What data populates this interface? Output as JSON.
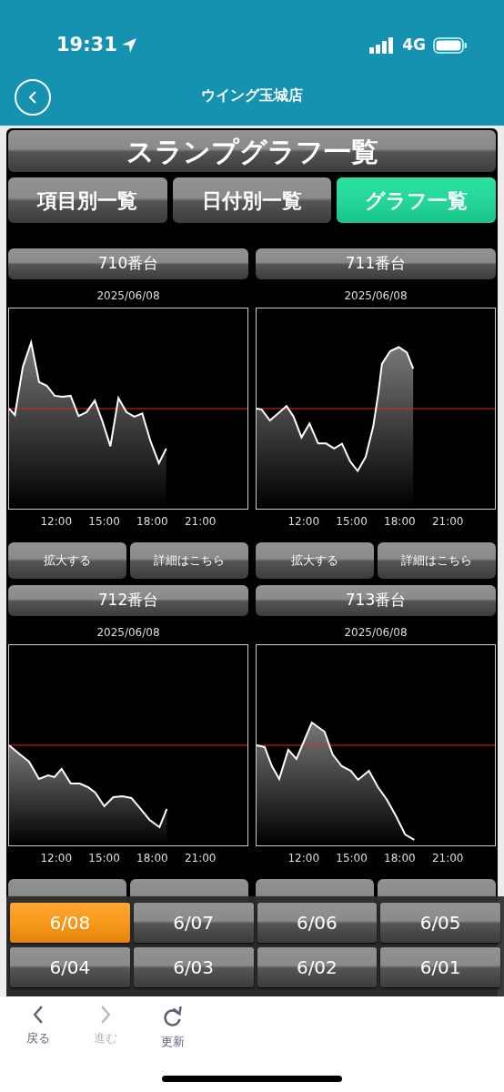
{
  "status_bar": {
    "time": "19:31",
    "network": "4G"
  },
  "header": {
    "title": "ウイング玉城店"
  },
  "page_title": "スランプグラフ一覧",
  "tabs": [
    {
      "label": "項目別一覧",
      "selected": false
    },
    {
      "label": "日付別一覧",
      "selected": false
    },
    {
      "label": "グラフ一覧",
      "selected": true
    }
  ],
  "machines": [
    {
      "label": "710番台",
      "date": "2025/06/08",
      "x_ticks": [
        "12:00",
        "15:00",
        "18:00",
        "21:00"
      ],
      "buttons": [
        "拡大する",
        "詳細はこちら"
      ]
    },
    {
      "label": "711番台",
      "date": "2025/06/08",
      "x_ticks": [
        "12:00",
        "15:00",
        "18:00",
        "21:00"
      ],
      "buttons": [
        "拡大する",
        "詳細はこちら"
      ]
    },
    {
      "label": "712番台",
      "date": "2025/06/08",
      "x_ticks": [
        "12:00",
        "15:00",
        "18:00",
        "21:00"
      ]
    },
    {
      "label": "713番台",
      "date": "2025/06/08",
      "x_ticks": [
        "12:00",
        "15:00",
        "18:00",
        "21:00"
      ]
    }
  ],
  "dates": [
    {
      "label": "6/08",
      "selected": true
    },
    {
      "label": "6/07",
      "selected": false
    },
    {
      "label": "6/06",
      "selected": false
    },
    {
      "label": "6/05",
      "selected": false
    },
    {
      "label": "6/04",
      "selected": false
    },
    {
      "label": "6/03",
      "selected": false
    },
    {
      "label": "6/02",
      "selected": false
    },
    {
      "label": "6/01",
      "selected": false
    }
  ],
  "toolbar": [
    {
      "kind": "back",
      "label": "戻る",
      "disabled": false
    },
    {
      "kind": "forward",
      "label": "進む",
      "disabled": true
    },
    {
      "kind": "reload",
      "label": "更新",
      "disabled": false
    }
  ]
}
